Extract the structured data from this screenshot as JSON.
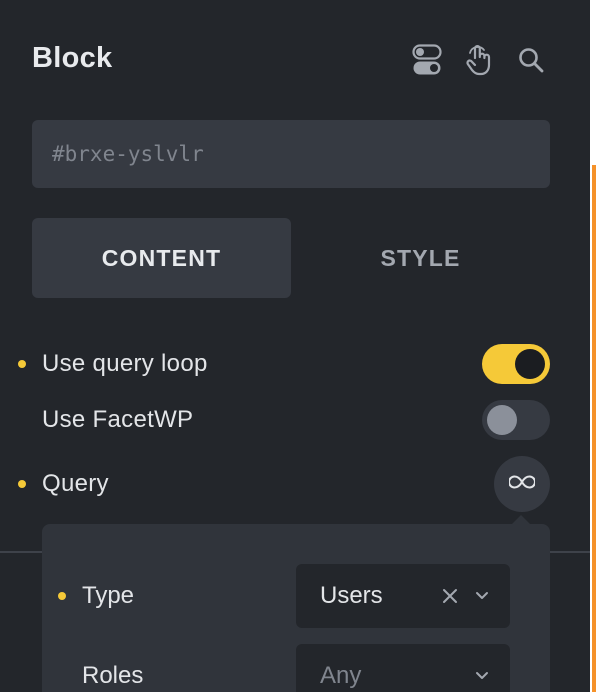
{
  "panel": {
    "title": "Block",
    "header_icons": [
      "toggle-switches-icon",
      "hand-pointer-icon",
      "search-icon"
    ]
  },
  "element_id": {
    "placeholder": "#brxe-yslvlr"
  },
  "tabs": [
    {
      "label": "CONTENT",
      "active": true
    },
    {
      "label": "STYLE",
      "active": false
    }
  ],
  "controls": {
    "use_query_loop": {
      "label": "Use query loop",
      "enabled": true
    },
    "use_facetwp": {
      "label": "Use FacetWP",
      "enabled": false
    },
    "query": {
      "label": "Query",
      "icon": "infinity-icon"
    }
  },
  "query_popover": {
    "type": {
      "label": "Type",
      "value": "Users",
      "icons": [
        "clear-icon",
        "chevron-down-icon"
      ]
    },
    "roles": {
      "label": "Roles",
      "placeholder": "Any",
      "icons": [
        "chevron-down-icon"
      ]
    }
  },
  "colors": {
    "background": "#23262b",
    "field": "#363a42",
    "accent_yellow": "#f5c938",
    "accent_orange": "#f5922a"
  }
}
